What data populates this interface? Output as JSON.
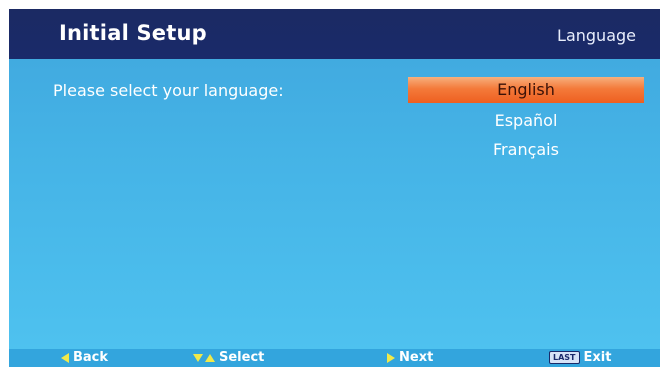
{
  "header": {
    "title": "Initial Setup",
    "section": "Language"
  },
  "main": {
    "prompt": "Please select your language:",
    "languages": [
      {
        "label": "English",
        "selected": true
      },
      {
        "label": "Español",
        "selected": false
      },
      {
        "label": "Français",
        "selected": false
      }
    ]
  },
  "footer": {
    "back": "Back",
    "select": "Select",
    "next": "Next",
    "last_key": "LAST",
    "exit": "Exit"
  },
  "colors": {
    "header_bg": "#1a2a6a",
    "screen_bg": "#45b3e6",
    "highlight": "#f47a3a",
    "icon_yellow": "#f0e94a"
  },
  "icons": [
    "arrow-left-icon",
    "arrow-down-icon",
    "arrow-up-icon",
    "arrow-right-icon",
    "last-key-icon"
  ]
}
